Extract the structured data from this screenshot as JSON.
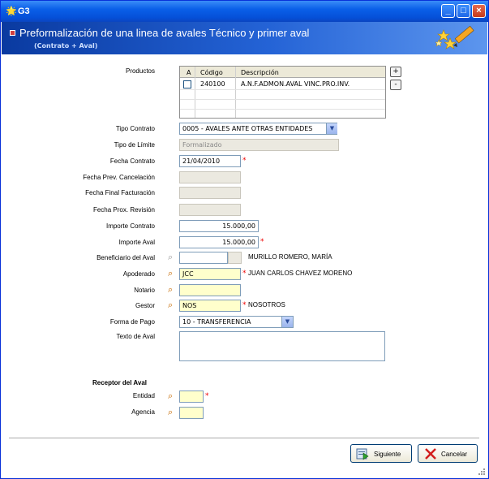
{
  "window": {
    "title": "G3"
  },
  "header": {
    "title": "Preformalización de una linea de avales Técnico y primer aval",
    "subtitle": "(Contrato + Aval)"
  },
  "productos": {
    "label": "Productos",
    "columns": [
      "A",
      "Código",
      "Descripción"
    ],
    "rows": [
      {
        "checked": false,
        "codigo": "240100",
        "descripcion": "A.N.F.ADMON.AVAL VINC.PRO.INV."
      }
    ],
    "add_label": "+",
    "remove_label": "-"
  },
  "form": {
    "tipo_contrato": {
      "label": "Tipo Contrato",
      "value": "0005 - AVALES ANTE OTRAS ENTIDADES"
    },
    "tipo_limite": {
      "label": "Tipo de Límite",
      "value": "Formalizado"
    },
    "fecha_contrato": {
      "label": "Fecha Contrato",
      "value": "21/04/2010"
    },
    "fecha_prev_cancelacion": {
      "label": "Fecha Prev. Cancelación",
      "value": ""
    },
    "fecha_final_facturacion": {
      "label": "Fecha Final Facturación",
      "value": ""
    },
    "fecha_prox_revision": {
      "label": "Fecha Prox. Revisión",
      "value": ""
    },
    "importe_contrato": {
      "label": "Importe Contrato",
      "value": "15.000,00"
    },
    "importe_aval": {
      "label": "Importe Aval",
      "value": "15.000,00"
    },
    "beneficiario": {
      "label": "Beneficiario del Aval",
      "value": "",
      "name": "MURILLO ROMERO, MARÍA"
    },
    "apoderado": {
      "label": "Apoderado",
      "value": "JCC",
      "name": "JUAN CARLOS CHAVEZ MORENO"
    },
    "notario": {
      "label": "Notario",
      "value": ""
    },
    "gestor": {
      "label": "Gestor",
      "value": "NOS",
      "name": "NOSOTROS"
    },
    "forma_pago": {
      "label": "Forma de Pago",
      "value": "10 - TRANSFERENCIA"
    },
    "texto_aval": {
      "label": "Texto de Aval",
      "value": ""
    }
  },
  "receptor": {
    "title": "Receptor del Aval",
    "entidad": {
      "label": "Entidad",
      "value": ""
    },
    "agencia": {
      "label": "Agencia",
      "value": ""
    }
  },
  "buttons": {
    "siguiente": "Siguiente",
    "cancelar": "Cancelar"
  },
  "required_mark": "*",
  "colors": {
    "title_bar": "#0a5fe8",
    "header_bg": "#1f55c8",
    "required_field": "#ffffcc",
    "required_mark": "#e00000"
  }
}
